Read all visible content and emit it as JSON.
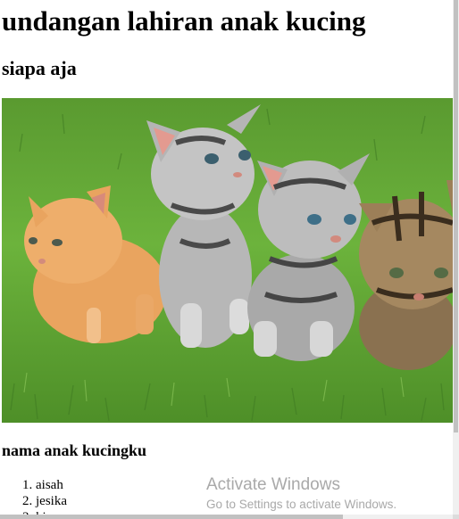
{
  "page": {
    "heading": "undangan lahiran anak kucing",
    "subheading": "siapa aja",
    "photo_alt": "four kittens on grass",
    "list_heading": "nama anak kucingku",
    "kitten_names": [
      "aisah",
      "jesika",
      "ki"
    ]
  },
  "watermark": {
    "title": "Activate Windows",
    "subtitle": "Go to Settings to activate Windows."
  },
  "colors": {
    "grass_dark": "#3f7a22",
    "grass_light": "#7cc24a",
    "orange_kitten": "#e8a35e",
    "silver_kitten": "#b9b9b9",
    "watermark_text": "#a9a9a9"
  }
}
